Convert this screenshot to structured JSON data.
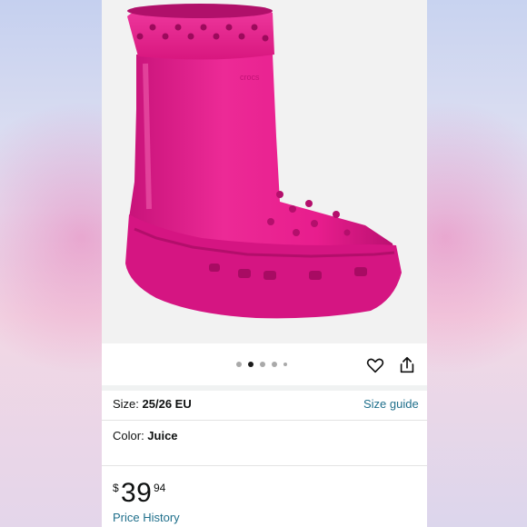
{
  "carousel": {
    "dot_count": 5,
    "active_index": 1,
    "brand_embossing": "crocs"
  },
  "actions": {
    "wishlist_icon": "heart-icon",
    "share_icon": "share-icon"
  },
  "size": {
    "label": "Size:",
    "value": "25/26 EU",
    "guide_link": "Size guide"
  },
  "color": {
    "label": "Color:",
    "value": "Juice"
  },
  "price": {
    "symbol": "$",
    "whole": "39",
    "fraction": "94"
  },
  "price_history_link": "Price History",
  "colors": {
    "product": "#e6198a",
    "link": "#1f6f8b"
  }
}
